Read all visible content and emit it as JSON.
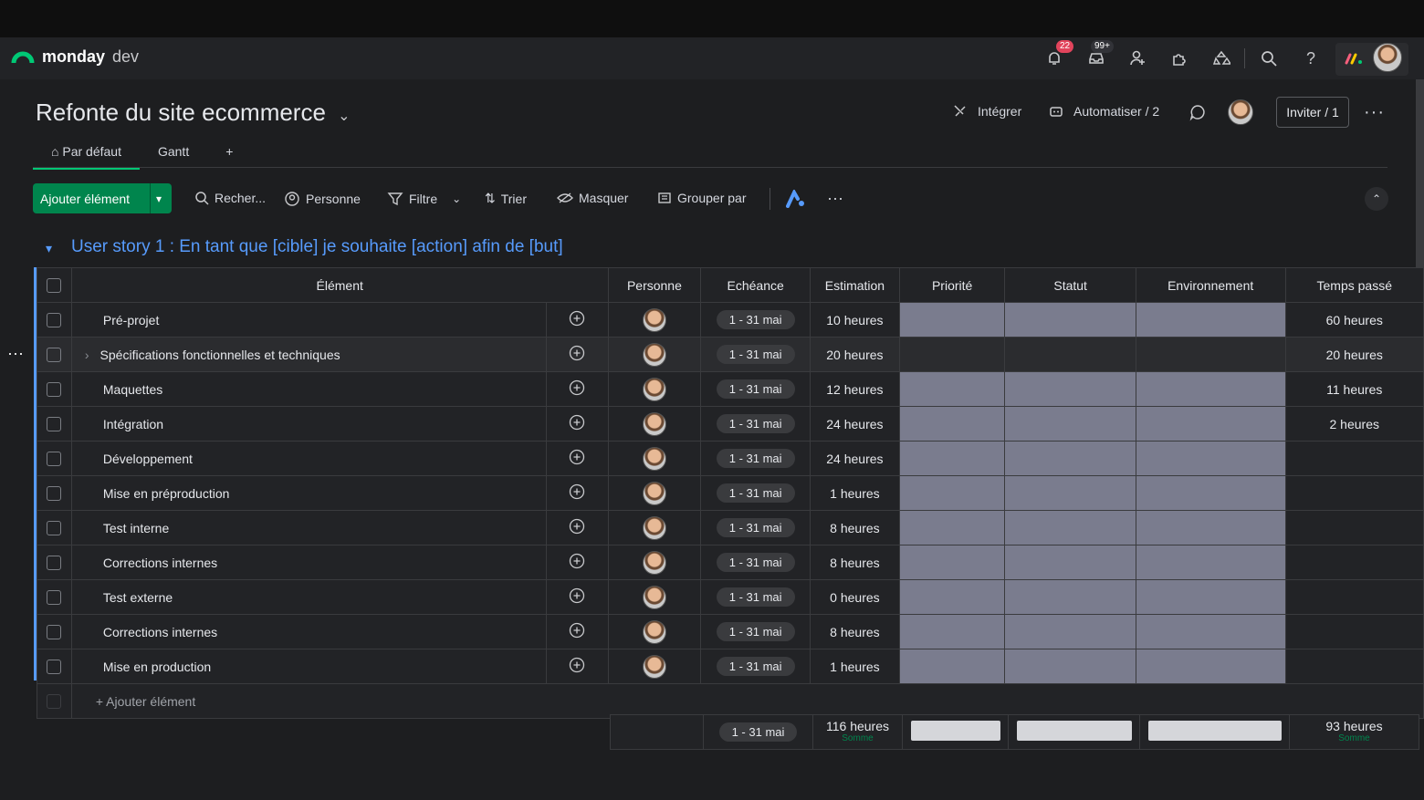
{
  "app": {
    "brand_bold": "monday",
    "brand_light": "dev",
    "notif_count": "22",
    "inbox_count": "99+"
  },
  "board": {
    "title": "Refonte du site ecommerce",
    "actions": {
      "integrate": "Intégrer",
      "automate": "Automatiser / 2",
      "invite": "Inviter / 1"
    },
    "tabs": [
      {
        "label": "Par défaut"
      },
      {
        "label": "Gantt"
      },
      {
        "label": "+"
      }
    ]
  },
  "toolbar": {
    "add_item": "Ajouter élément",
    "search": "Recher...",
    "person": "Personne",
    "filter": "Filtre",
    "sort": "Trier",
    "hide": "Masquer",
    "group_by": "Grouper par"
  },
  "group": {
    "title": "User story 1 : En tant que [cible] je souhaite [action] afin de [but]",
    "columns": [
      "Élément",
      "Personne",
      "Echéance",
      "Estimation",
      "Priorité",
      "Statut",
      "Environnement",
      "Temps passé"
    ],
    "rows": [
      {
        "name": "Pré-projet",
        "date": "1 - 31 mai",
        "estimation": "10 heures",
        "spent": "60 heures"
      },
      {
        "name": "Spécifications fonctionnelles et techniques",
        "date": "1 - 31 mai",
        "estimation": "20 heures",
        "spent": "20 heures"
      },
      {
        "name": "Maquettes",
        "date": "1 - 31 mai",
        "estimation": "12 heures",
        "spent": "11 heures"
      },
      {
        "name": "Intégration",
        "date": "1 - 31 mai",
        "estimation": "24 heures",
        "spent": "2 heures"
      },
      {
        "name": "Développement",
        "date": "1 - 31 mai",
        "estimation": "24 heures",
        "spent": ""
      },
      {
        "name": "Mise en préproduction",
        "date": "1 - 31 mai",
        "estimation": "1 heures",
        "spent": ""
      },
      {
        "name": "Test interne",
        "date": "1 - 31 mai",
        "estimation": "8 heures",
        "spent": ""
      },
      {
        "name": "Corrections internes",
        "date": "1 - 31 mai",
        "estimation": "8 heures",
        "spent": ""
      },
      {
        "name": "Test externe",
        "date": "1 - 31 mai",
        "estimation": "0 heures",
        "spent": ""
      },
      {
        "name": "Corrections internes",
        "date": "1 - 31 mai",
        "estimation": "8 heures",
        "spent": ""
      },
      {
        "name": "Mise en production",
        "date": "1 - 31 mai",
        "estimation": "1 heures",
        "spent": ""
      }
    ],
    "add_item": "+ Ajouter élément",
    "summary": {
      "date": "1 - 31 mai",
      "estimation": "116 heures",
      "estimation_sub": "Somme",
      "spent": "93 heures",
      "spent_sub": "Somme"
    }
  }
}
